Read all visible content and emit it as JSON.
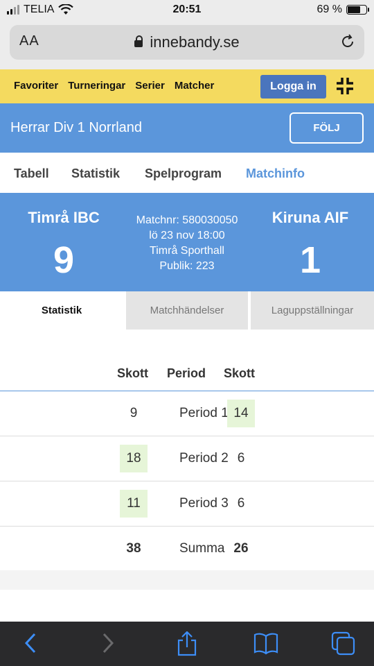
{
  "status": {
    "carrier": "TELIA",
    "time": "20:51",
    "battery": "69 %"
  },
  "browser": {
    "text_size_label": "AA",
    "url": "innebandy.se"
  },
  "nav": {
    "links": [
      "Favoriter",
      "Turneringar",
      "Serier",
      "Matcher"
    ],
    "login_label": "Logga in"
  },
  "division": {
    "title": "Herrar Div 1 Norrland",
    "follow_label": "FÖLJ"
  },
  "main_tabs": [
    "Tabell",
    "Statistik",
    "Spelprogram",
    "Matchinfo"
  ],
  "match": {
    "home_team": "Timrå IBC",
    "away_team": "Kiruna AIF",
    "home_score": "9",
    "away_score": "1",
    "match_number": "Matchnr: 580030050",
    "date": "lö 23 nov 18:00",
    "venue": "Timrå Sporthall",
    "attendance": "Publik: 223"
  },
  "sub_tabs": [
    "Statistik",
    "Matchhändelser",
    "Laguppställningar"
  ],
  "stats": {
    "headers": {
      "home": "Skott",
      "period": "Period",
      "away": "Skott"
    },
    "rows": [
      {
        "home": "9",
        "period": "Period 1",
        "away": "14"
      },
      {
        "home": "18",
        "period": "Period 2",
        "away": "6"
      },
      {
        "home": "11",
        "period": "Period 3",
        "away": "6"
      },
      {
        "home": "38",
        "period": "Summa",
        "away": "26"
      }
    ]
  },
  "colors": {
    "accent": "#5b96db",
    "nav_bg": "#f4da5f",
    "button": "#4a75bd",
    "highlight": "#e6f5d8"
  }
}
